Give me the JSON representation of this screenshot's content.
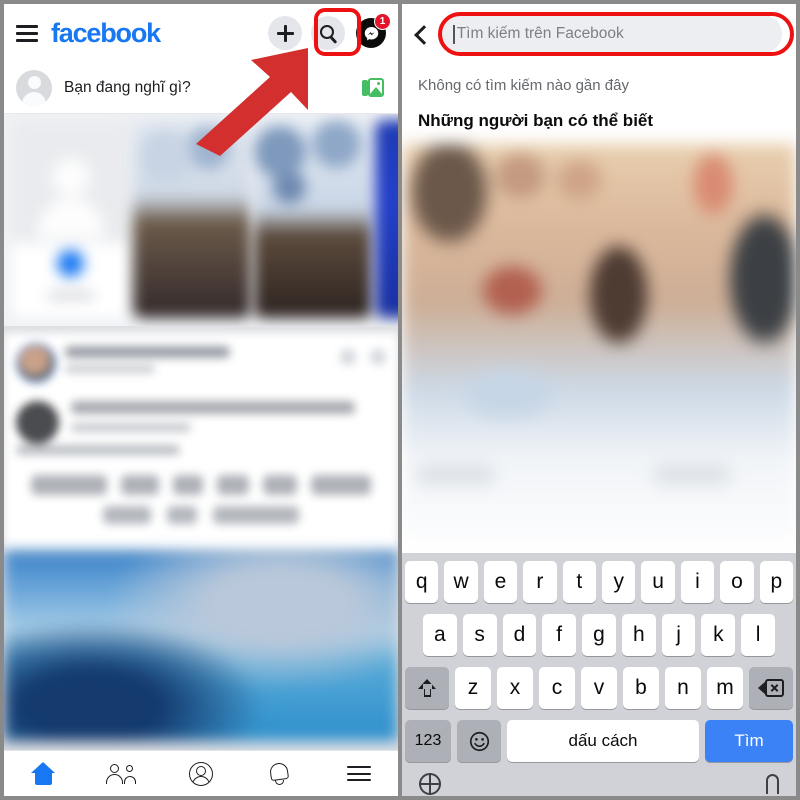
{
  "left_panel": {
    "header": {
      "menu_icon": "hamburger-icon",
      "logo_text": "facebook",
      "logo_color": "#1877F2",
      "buttons": [
        {
          "name": "create-button",
          "icon": "plus-icon"
        },
        {
          "name": "search-button",
          "icon": "search-icon",
          "highlighted": true
        },
        {
          "name": "messenger-button",
          "icon": "messenger-icon",
          "badge": "1"
        }
      ]
    },
    "composer": {
      "avatar_icon": "default-avatar-icon",
      "prompt_text": "Bạn đang nghĩ gì?",
      "photo_icon": "photo-gallery-icon",
      "photo_icon_color": "#45bd62"
    },
    "annotation": {
      "arrow_color": "#d32f2f",
      "highlight_color": "#ee1111",
      "highlight_target": "search-button"
    },
    "bottom_nav": [
      {
        "name": "nav-home",
        "icon": "home-icon",
        "active": true
      },
      {
        "name": "nav-friends",
        "icon": "friends-icon",
        "active": false
      },
      {
        "name": "nav-profile",
        "icon": "profile-icon",
        "active": false
      },
      {
        "name": "nav-notifications",
        "icon": "bell-icon",
        "active": false
      },
      {
        "name": "nav-menu",
        "icon": "menu-icon",
        "active": false
      }
    ]
  },
  "right_panel": {
    "header": {
      "back_icon": "back-chevron-icon",
      "search_placeholder": "Tìm kiếm trên Facebook",
      "search_value": "",
      "highlighted": true
    },
    "recent_searches_text": "Không có tìm kiếm nào gần đây",
    "section_title": "Những người bạn có thể biết",
    "keyboard": {
      "row1": [
        "q",
        "w",
        "e",
        "r",
        "t",
        "y",
        "u",
        "i",
        "o",
        "p"
      ],
      "row2": [
        "a",
        "s",
        "d",
        "f",
        "g",
        "h",
        "j",
        "k",
        "l"
      ],
      "row3": [
        "z",
        "x",
        "c",
        "v",
        "b",
        "n",
        "m"
      ],
      "shift_icon": "shift-icon",
      "backspace_icon": "backspace-icon",
      "numeric_label": "123",
      "emoji_icon": "emoji-icon",
      "space_label": "dấu cách",
      "go_label": "Tìm",
      "go_color": "#3b82f6",
      "globe_icon": "globe-icon",
      "mic_icon": "microphone-icon"
    }
  }
}
